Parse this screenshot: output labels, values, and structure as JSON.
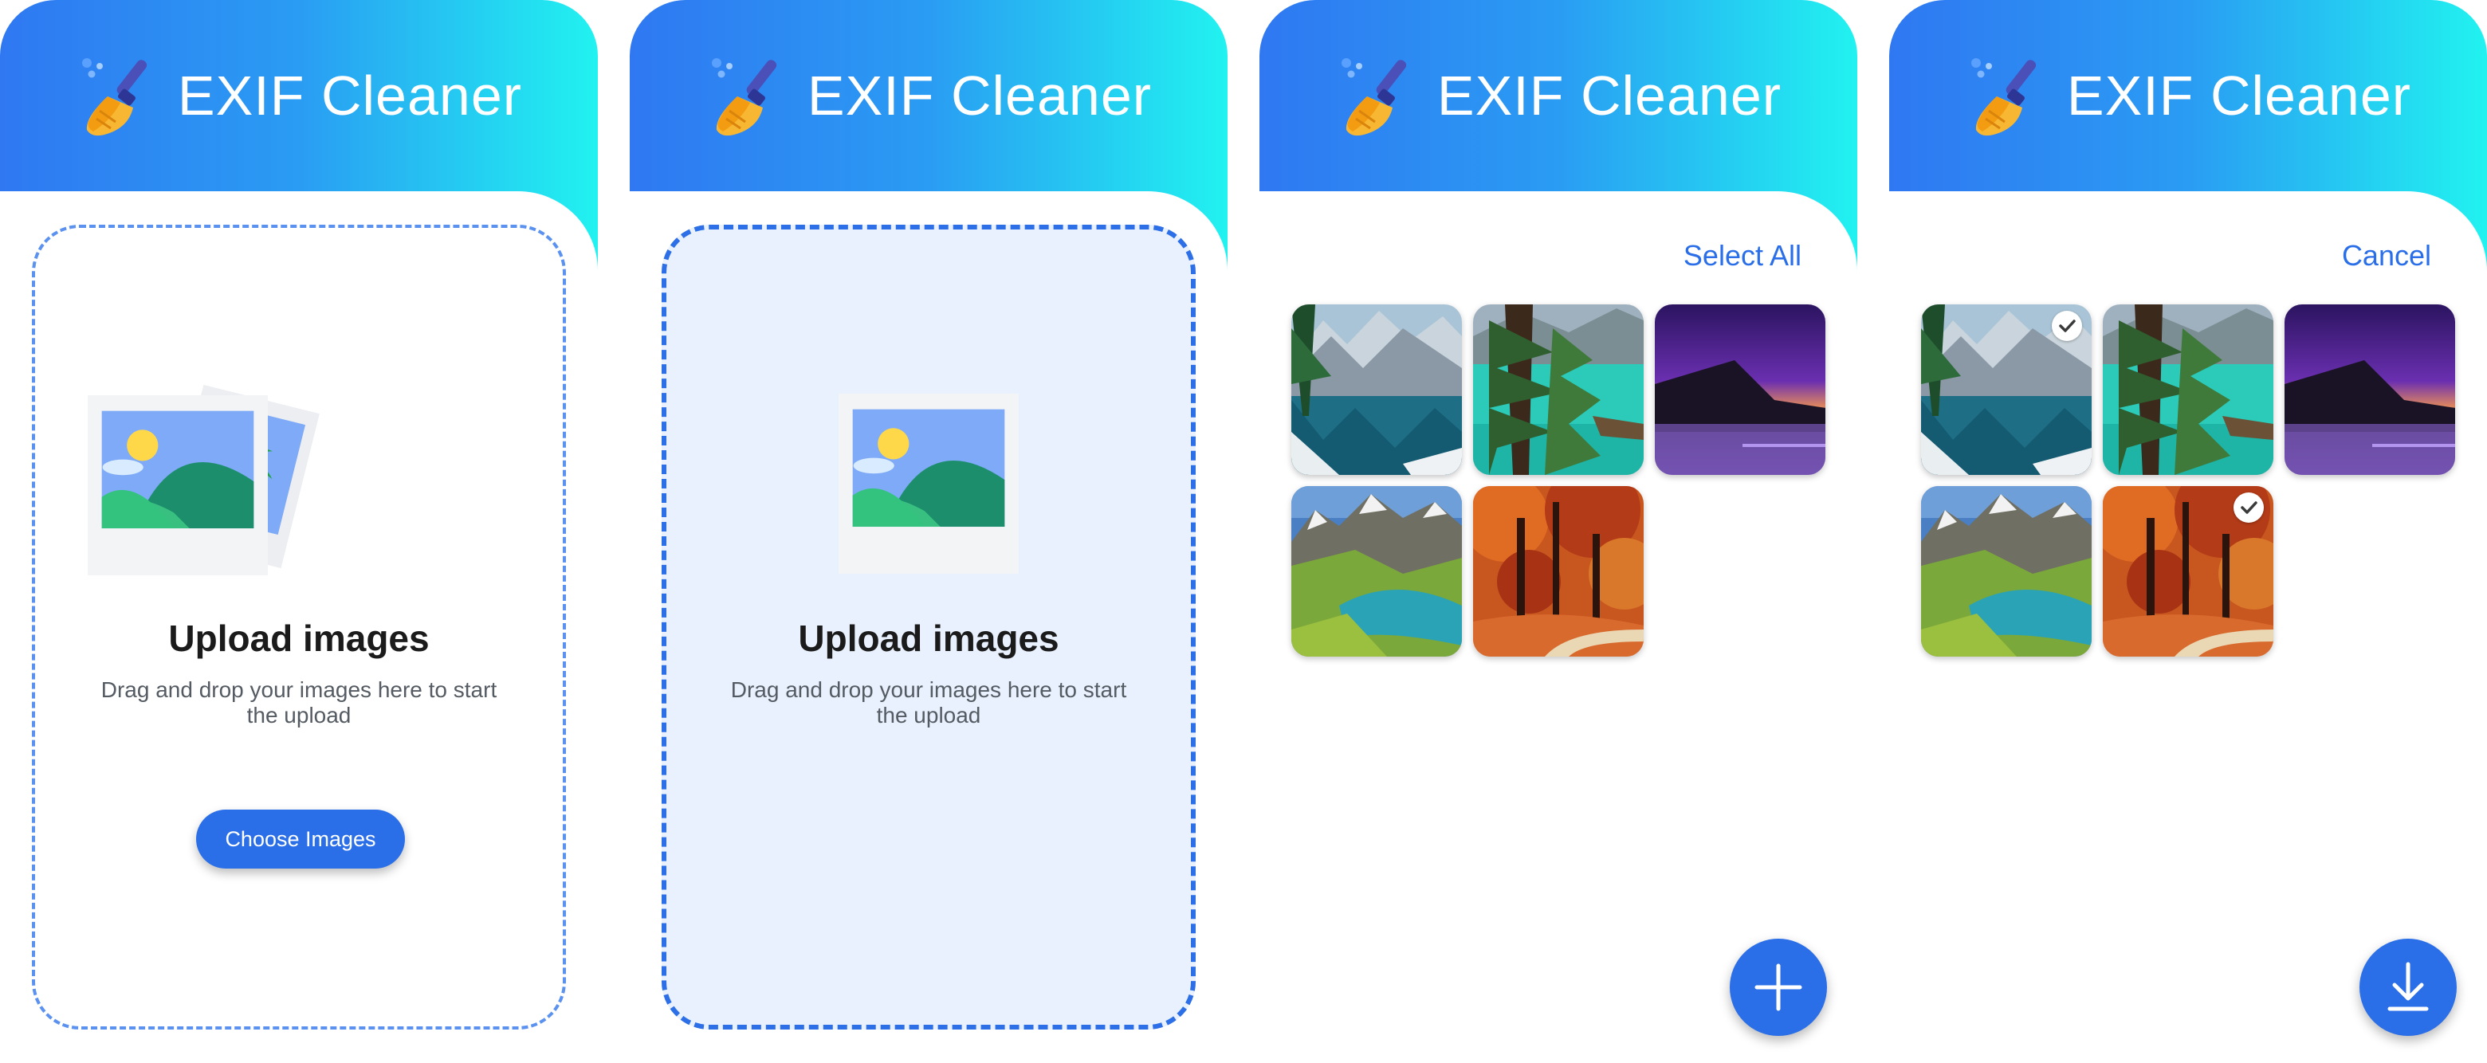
{
  "app": {
    "title": "EXIF Cleaner"
  },
  "upload": {
    "heading": "Upload images",
    "subtitle": "Drag and drop your images here to start the upload",
    "choose_button": "Choose Images"
  },
  "gallery": {
    "select_all": "Select All",
    "cancel": "Cancel"
  },
  "icons": {
    "logo": "broom-icon",
    "add": "plus-icon",
    "download": "download-icon",
    "check": "check-icon",
    "upload_illustration": "photos-illustration"
  },
  "colors": {
    "accent": "#2a6ee8",
    "header_gradient_start": "#2f78f2",
    "header_gradient_end": "#21f2f0",
    "dropzone_active_bg": "#e8f1fd"
  },
  "thumbnails": [
    {
      "name": "mountain-lake"
    },
    {
      "name": "turquoise-lake-trees"
    },
    {
      "name": "purple-dusk-sea"
    },
    {
      "name": "alpine-valley-lake"
    },
    {
      "name": "autumn-forest-path"
    }
  ],
  "selection": {
    "screen4_selected": [
      "mountain-lake",
      "autumn-forest-path"
    ]
  }
}
